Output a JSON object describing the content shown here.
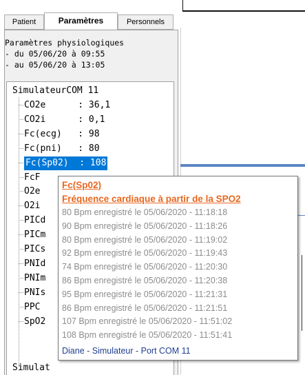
{
  "tabs": {
    "patient": "Patient",
    "parametres": "Paramètres",
    "personnels": "Personnels"
  },
  "info": {
    "line1": "Paramètres physiologiques",
    "line2": "- du 05/06/20 à 09:55",
    "line3": "- au 05/06/20 à 13:05"
  },
  "tree": {
    "root": "SimulateurCOM 11",
    "second_root": "Simulat",
    "items": [
      {
        "label": "CO2e      : 36,1"
      },
      {
        "label": "CO2i      : 0,1"
      },
      {
        "label": "Fc(ecg)   : 98"
      },
      {
        "label": "Fc(pni)   : 80"
      },
      {
        "label": "Fc(Sp02)  : 108"
      },
      {
        "label": "FcF"
      },
      {
        "label": "O2e"
      },
      {
        "label": "O2i"
      },
      {
        "label": "PICd"
      },
      {
        "label": "PICm"
      },
      {
        "label": "PICs"
      },
      {
        "label": "PNId"
      },
      {
        "label": "PNIm"
      },
      {
        "label": "PNIs"
      },
      {
        "label": "PPC"
      },
      {
        "label": "SpO2"
      }
    ],
    "selected_index": 4
  },
  "tooltip": {
    "title": "Fc(Sp02)",
    "subtitle": "Fréquence cardiaque à partir de la SPO2",
    "records": [
      "80 Bpm enregistré le 05/06/2020 - 11:18:18",
      "90 Bpm enregistré le 05/06/2020 - 11:18:26",
      "80 Bpm enregistré le 05/06/2020 - 11:19:02",
      "92 Bpm enregistré le 05/06/2020 - 11:19:43",
      "74 Bpm enregistré le 05/06/2020 - 11:20:30",
      "86 Bpm enregistré le 05/06/2020 - 11:20:38",
      "95 Bpm enregistré le 05/06/2020 - 11:21:31",
      "86 Bpm enregistré le 05/06/2020 - 11:21:51",
      "107 Bpm enregistré le 05/06/2020 - 11:51:02",
      "108 Bpm enregistré le 05/06/2020 - 11:51:41"
    ],
    "footer": "Diane - Simulateur - Port COM 11"
  },
  "colors": {
    "selection": "#0078d7",
    "tooltip_title": "#e8671e",
    "tooltip_record": "#8c8c8c",
    "tooltip_footer": "#1f3f8f"
  }
}
